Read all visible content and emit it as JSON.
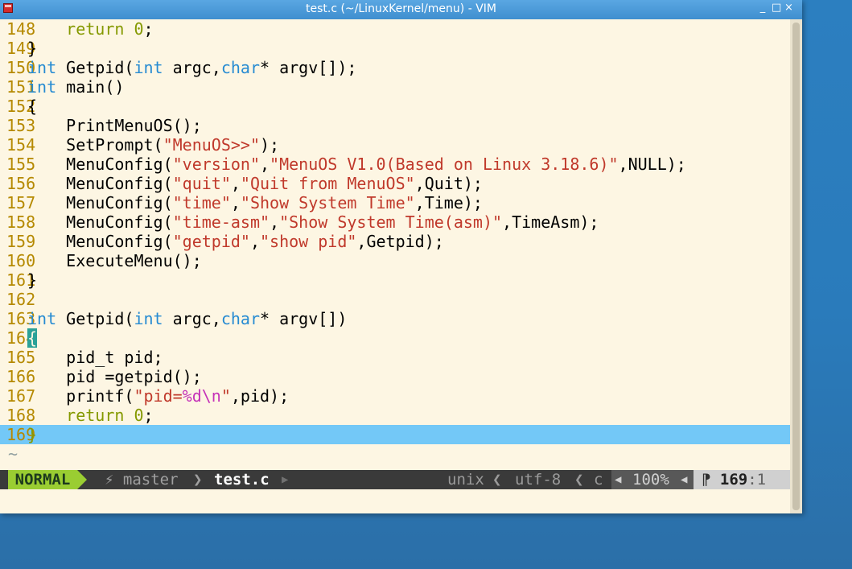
{
  "window": {
    "title": "test.c (~/LinuxKernel/menu) - VIM",
    "buttons": {
      "minimize": "_",
      "maximize": "□",
      "close": "×"
    }
  },
  "editor": {
    "lines": [
      {
        "num": "148",
        "tokens": [
          {
            "t": "    "
          },
          {
            "t": "return",
            "c": "kw"
          },
          {
            "t": " "
          },
          {
            "t": "0",
            "c": "num"
          },
          {
            "t": ";"
          }
        ]
      },
      {
        "num": "149",
        "tokens": [
          {
            "t": "}"
          }
        ]
      },
      {
        "num": "150",
        "tokens": [
          {
            "t": "int",
            "c": "ty"
          },
          {
            "t": " Getpid("
          },
          {
            "t": "int",
            "c": "ty"
          },
          {
            "t": " argc,"
          },
          {
            "t": "char",
            "c": "ty"
          },
          {
            "t": "* argv[]);"
          }
        ]
      },
      {
        "num": "151",
        "tokens": [
          {
            "t": "int",
            "c": "ty"
          },
          {
            "t": " main()"
          }
        ]
      },
      {
        "num": "152",
        "tokens": [
          {
            "t": "{"
          }
        ]
      },
      {
        "num": "153",
        "tokens": [
          {
            "t": "    PrintMenuOS();"
          }
        ]
      },
      {
        "num": "154",
        "tokens": [
          {
            "t": "    SetPrompt("
          },
          {
            "t": "\"MenuOS>>\"",
            "c": "str"
          },
          {
            "t": ");"
          }
        ]
      },
      {
        "num": "155",
        "tokens": [
          {
            "t": "    MenuConfig("
          },
          {
            "t": "\"version\"",
            "c": "str"
          },
          {
            "t": ","
          },
          {
            "t": "\"MenuOS V1.0(Based on Linux 3.18.6)\"",
            "c": "str"
          },
          {
            "t": ",NULL);"
          }
        ]
      },
      {
        "num": "156",
        "tokens": [
          {
            "t": "    MenuConfig("
          },
          {
            "t": "\"quit\"",
            "c": "str"
          },
          {
            "t": ","
          },
          {
            "t": "\"Quit from MenuOS\"",
            "c": "str"
          },
          {
            "t": ",Quit);"
          }
        ]
      },
      {
        "num": "157",
        "tokens": [
          {
            "t": "    MenuConfig("
          },
          {
            "t": "\"time\"",
            "c": "str"
          },
          {
            "t": ","
          },
          {
            "t": "\"Show System Time\"",
            "c": "str"
          },
          {
            "t": ",Time);"
          }
        ]
      },
      {
        "num": "158",
        "tokens": [
          {
            "t": "    MenuConfig("
          },
          {
            "t": "\"time-asm\"",
            "c": "str"
          },
          {
            "t": ","
          },
          {
            "t": "\"Show System Time(asm)\"",
            "c": "str"
          },
          {
            "t": ",TimeAsm);"
          }
        ]
      },
      {
        "num": "159",
        "tokens": [
          {
            "t": "    MenuConfig("
          },
          {
            "t": "\"getpid\"",
            "c": "str"
          },
          {
            "t": ","
          },
          {
            "t": "\"show pid\"",
            "c": "str"
          },
          {
            "t": ",Getpid);"
          }
        ]
      },
      {
        "num": "160",
        "tokens": [
          {
            "t": "    ExecuteMenu();"
          }
        ]
      },
      {
        "num": "161",
        "tokens": [
          {
            "t": "}"
          }
        ]
      },
      {
        "num": "162",
        "tokens": []
      },
      {
        "num": "163",
        "tokens": [
          {
            "t": "int",
            "c": "ty"
          },
          {
            "t": " Getpid("
          },
          {
            "t": "int",
            "c": "ty"
          },
          {
            "t": " argc,"
          },
          {
            "t": "char",
            "c": "ty"
          },
          {
            "t": "* argv[])"
          }
        ]
      },
      {
        "num": "164",
        "tokens": [
          {
            "t": "{",
            "c": "brace-hl"
          }
        ]
      },
      {
        "num": "165",
        "tokens": [
          {
            "t": "    pid_t pid;"
          }
        ]
      },
      {
        "num": "166",
        "tokens": [
          {
            "t": "    pid =getpid();"
          }
        ]
      },
      {
        "num": "167",
        "tokens": [
          {
            "t": "    printf("
          },
          {
            "t": "\"pid=",
            "c": "str"
          },
          {
            "t": "%d\\n",
            "c": "fmt"
          },
          {
            "t": "\"",
            "c": "str"
          },
          {
            "t": ",pid);"
          }
        ]
      },
      {
        "num": "168",
        "tokens": [
          {
            "t": "    "
          },
          {
            "t": "return",
            "c": "kw"
          },
          {
            "t": " "
          },
          {
            "t": "0",
            "c": "num"
          },
          {
            "t": ";"
          }
        ]
      },
      {
        "num": "169",
        "tokens": [
          {
            "t": "}",
            "c": "kw"
          }
        ],
        "current": true
      }
    ],
    "filler": "~"
  },
  "statusline": {
    "mode": "NORMAL",
    "branch": "⚡ master",
    "branch_sep": "❯",
    "file": "test.c",
    "file_sep": "▶",
    "fileformat": "unix",
    "sep": "❮",
    "encoding": "utf-8",
    "filetype": "c",
    "pct_sep": "◀",
    "percent": "100%",
    "pos_sep": "◀",
    "line_icon": "⁋",
    "line": "169",
    "col": ":1"
  },
  "colors": {
    "background": "#fdf6e3",
    "line_number": "#b58900",
    "keyword": "#859900",
    "type": "#268bd2",
    "string": "#c0392b",
    "format": "#c533b8",
    "cursorline": "#73c8f7",
    "mode_bg": "#9acd32",
    "titlebar": "#3f8fcf"
  }
}
